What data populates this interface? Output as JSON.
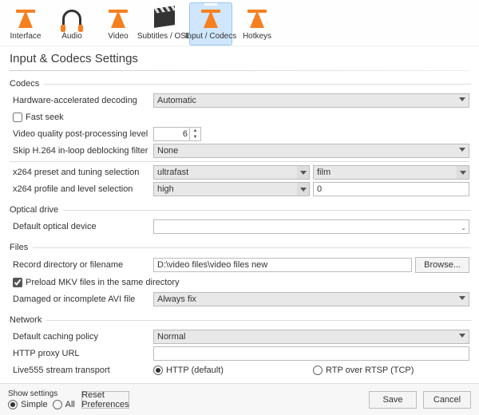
{
  "tabs": {
    "interface": "Interface",
    "audio": "Audio",
    "video": "Video",
    "subtitles": "Subtitles / OSD",
    "input": "Input / Codecs",
    "hotkeys": "Hotkeys"
  },
  "heading": "Input & Codecs Settings",
  "groups": {
    "codecs": {
      "legend": "Codecs",
      "hw_decoding_label": "Hardware-accelerated decoding",
      "hw_decoding_value": "Automatic",
      "fast_seek_label": "Fast seek",
      "pp_level_label": "Video quality post-processing level",
      "pp_level_value": "6",
      "skip_h264_label": "Skip H.264 in-loop deblocking filter",
      "skip_h264_value": "None",
      "x264_preset_label": "x264 preset and tuning selection",
      "x264_preset_value": "ultrafast",
      "x264_tune_value": "film",
      "x264_profile_label": "x264 profile and level selection",
      "x264_profile_value": "high",
      "x264_level_value": "0"
    },
    "optical": {
      "legend": "Optical drive",
      "default_device_label": "Default optical device",
      "default_device_value": ""
    },
    "files": {
      "legend": "Files",
      "record_label": "Record directory or filename",
      "record_value": "D:\\video files\\video files new",
      "browse_btn": "Browse...",
      "preload_mkv_label": "Preload MKV files in the same directory",
      "damaged_avi_label": "Damaged or incomplete AVI file",
      "damaged_avi_value": "Always fix"
    },
    "network": {
      "legend": "Network",
      "caching_label": "Default caching policy",
      "caching_value": "Normal",
      "http_proxy_label": "HTTP proxy URL",
      "http_proxy_value": "",
      "live555_label": "Live555 stream transport",
      "opt_http": "HTTP (default)",
      "opt_rtp": "RTP over RTSP (TCP)"
    }
  },
  "footer": {
    "show_settings": "Show settings",
    "simple": "Simple",
    "all": "All",
    "reset": "Reset Preferences",
    "save": "Save",
    "cancel": "Cancel"
  }
}
